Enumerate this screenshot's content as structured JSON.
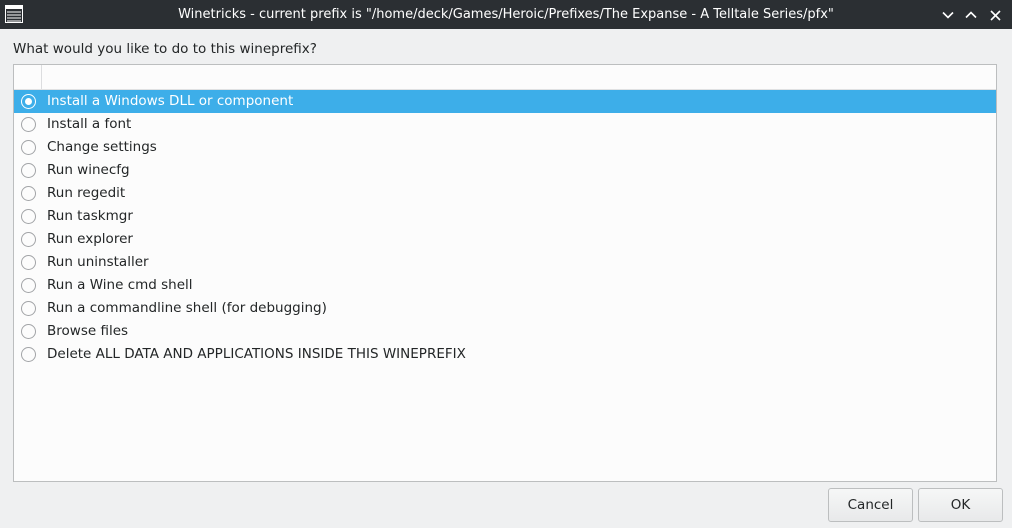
{
  "window": {
    "title": "Winetricks - current prefix is \"/home/deck/Games/Heroic/Prefixes/The Expanse - A Telltale Series/pfx\""
  },
  "titlebar": {
    "icons": [
      "app-menu-icon",
      "minimize-chevron-icon",
      "maximize-chevron-icon",
      "close-icon"
    ],
    "background": "#2b2f33"
  },
  "prompt": "What would you like to do to this wineprefix?",
  "options": [
    {
      "label": "Install a Windows DLL or component",
      "selected": true
    },
    {
      "label": "Install a font",
      "selected": false
    },
    {
      "label": "Change settings",
      "selected": false
    },
    {
      "label": "Run winecfg",
      "selected": false
    },
    {
      "label": "Run regedit",
      "selected": false
    },
    {
      "label": "Run taskmgr",
      "selected": false
    },
    {
      "label": "Run explorer",
      "selected": false
    },
    {
      "label": "Run uninstaller",
      "selected": false
    },
    {
      "label": "Run a Wine cmd shell",
      "selected": false
    },
    {
      "label": "Run a commandline shell (for debugging)",
      "selected": false
    },
    {
      "label": "Browse files",
      "selected": false
    },
    {
      "label": "Delete ALL DATA AND APPLICATIONS INSIDE THIS WINEPREFIX",
      "selected": false
    }
  ],
  "buttons": {
    "cancel": "Cancel",
    "ok": "OK"
  },
  "colors": {
    "selection": "#3daee9",
    "window_bg": "#eff0f1",
    "list_bg": "#fcfcfc"
  }
}
